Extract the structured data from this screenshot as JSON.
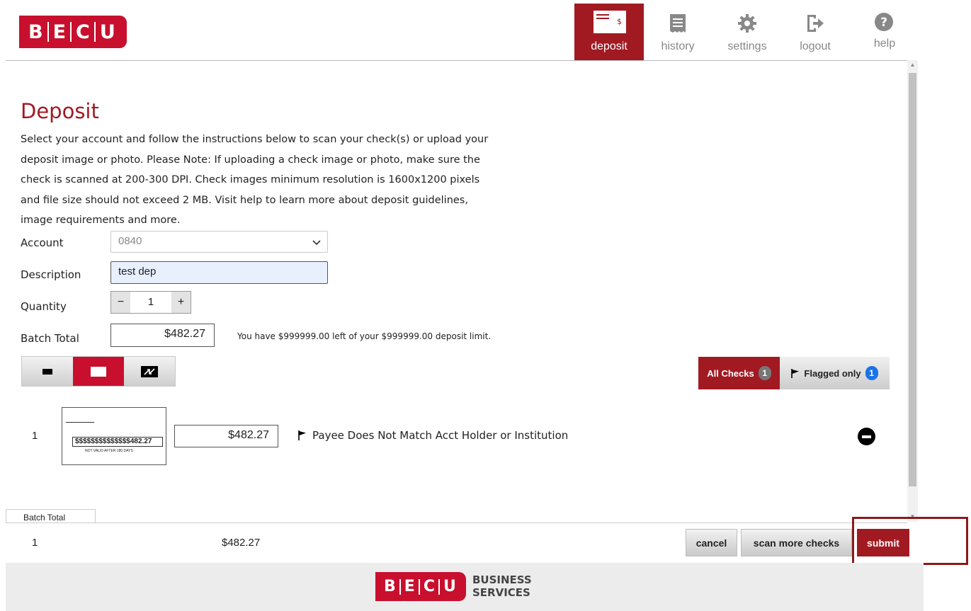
{
  "brand": {
    "logo_letters": [
      "B",
      "E",
      "C",
      "U"
    ],
    "footer_tagline_1": "BUSINESS",
    "footer_tagline_2": "SERVICES",
    "color": "#c8102e"
  },
  "nav": {
    "items": [
      {
        "label": "deposit",
        "icon": "check-deposit-icon",
        "active": true
      },
      {
        "label": "history",
        "icon": "receipt-icon",
        "active": false
      },
      {
        "label": "settings",
        "icon": "gear-icon",
        "active": false
      },
      {
        "label": "logout",
        "icon": "logout-icon",
        "active": false
      },
      {
        "label": "help",
        "icon": "question-circle-icon",
        "active": false
      }
    ]
  },
  "page": {
    "title": "Deposit",
    "intro_lines": [
      "Select your account and follow the instructions below to scan your check(s) or upload your",
      "deposit image or photo. Please Note: If uploading a check image or photo, make sure the",
      "check is scanned at 200-300 DPI. Check images minimum resolution is 1600x1200 pixels",
      "and file size should not exceed 2 MB. Visit help to learn more about deposit guidelines,",
      "image requirements and more."
    ]
  },
  "form": {
    "account_label": "Account",
    "account_value": "0840",
    "description_label": "Description",
    "description_value": "test dep",
    "quantity_label": "Quantity",
    "quantity_minus": "−",
    "quantity_value": "1",
    "quantity_plus": "+",
    "batch_total_label": "Batch Total",
    "batch_total_value": "$482.27",
    "limit_text": "You have $999999.00 left of your $999999.00 deposit limit."
  },
  "view_toggle": {
    "options": [
      "small-view-icon",
      "medium-view-icon",
      "expand-view-icon"
    ],
    "selected": 1
  },
  "filters": {
    "all_label": "All Checks",
    "all_count": "1",
    "flagged_label": "Flagged only",
    "flagged_count": "1"
  },
  "checks": [
    {
      "number": "1",
      "amount": "$482.27",
      "thumb_amount_text": "$$$$$$$$$$$$$$482.27",
      "thumb_footer_text": "NOT VALID AFTER 180 DAYS",
      "flag_message": "Payee Does Not Match Acct Holder or Institution"
    }
  ],
  "footer_bar": {
    "tab_label": "Batch Total",
    "count": "1",
    "amount": "$482.27",
    "cancel_label": "cancel",
    "scan_more_label": "scan more checks",
    "submit_label": "submit"
  }
}
